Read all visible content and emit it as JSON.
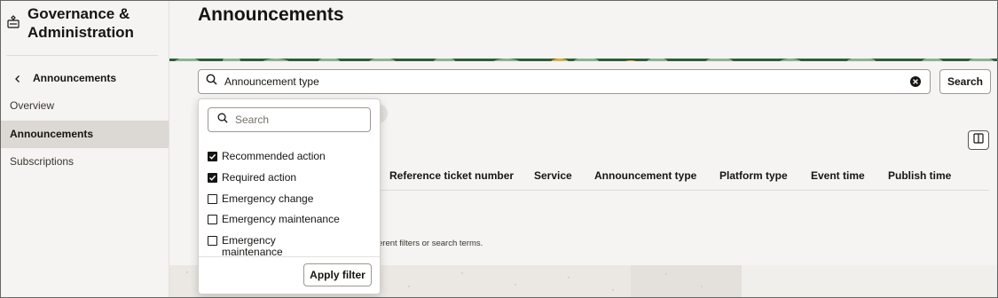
{
  "sidebar": {
    "title": "Governance & Administration",
    "back_label": "Announcements",
    "items": [
      {
        "label": "Overview",
        "active": false
      },
      {
        "label": "Announcements",
        "active": true
      },
      {
        "label": "Subscriptions",
        "active": false
      }
    ]
  },
  "main": {
    "title": "Announcements",
    "search": {
      "value": "Announcement type",
      "button_label": "Search"
    },
    "chip_fragment": ")",
    "table": {
      "headers": [
        "Reference ticket number",
        "Service",
        "Announcement type",
        "Platform type",
        "Event time",
        "Publish time"
      ]
    },
    "empty_message": "erent filters or search terms."
  },
  "dropdown": {
    "search_placeholder": "Search",
    "options": [
      {
        "label": "Recommended action",
        "checked": true
      },
      {
        "label": "Required action",
        "checked": true
      },
      {
        "label": "Emergency change",
        "checked": false
      },
      {
        "label": "Emergency maintenance",
        "checked": false
      },
      {
        "label": "Emergency maintenance completed",
        "checked": false
      }
    ],
    "apply_label": "Apply filter"
  },
  "colors": {
    "banner_green": "#2e5e3a",
    "banner_light": "#9cc4a4",
    "banner_accent": "#d9b347",
    "sidebar_bg": "#f5f4f2",
    "active_bg": "#dcd8d3"
  }
}
